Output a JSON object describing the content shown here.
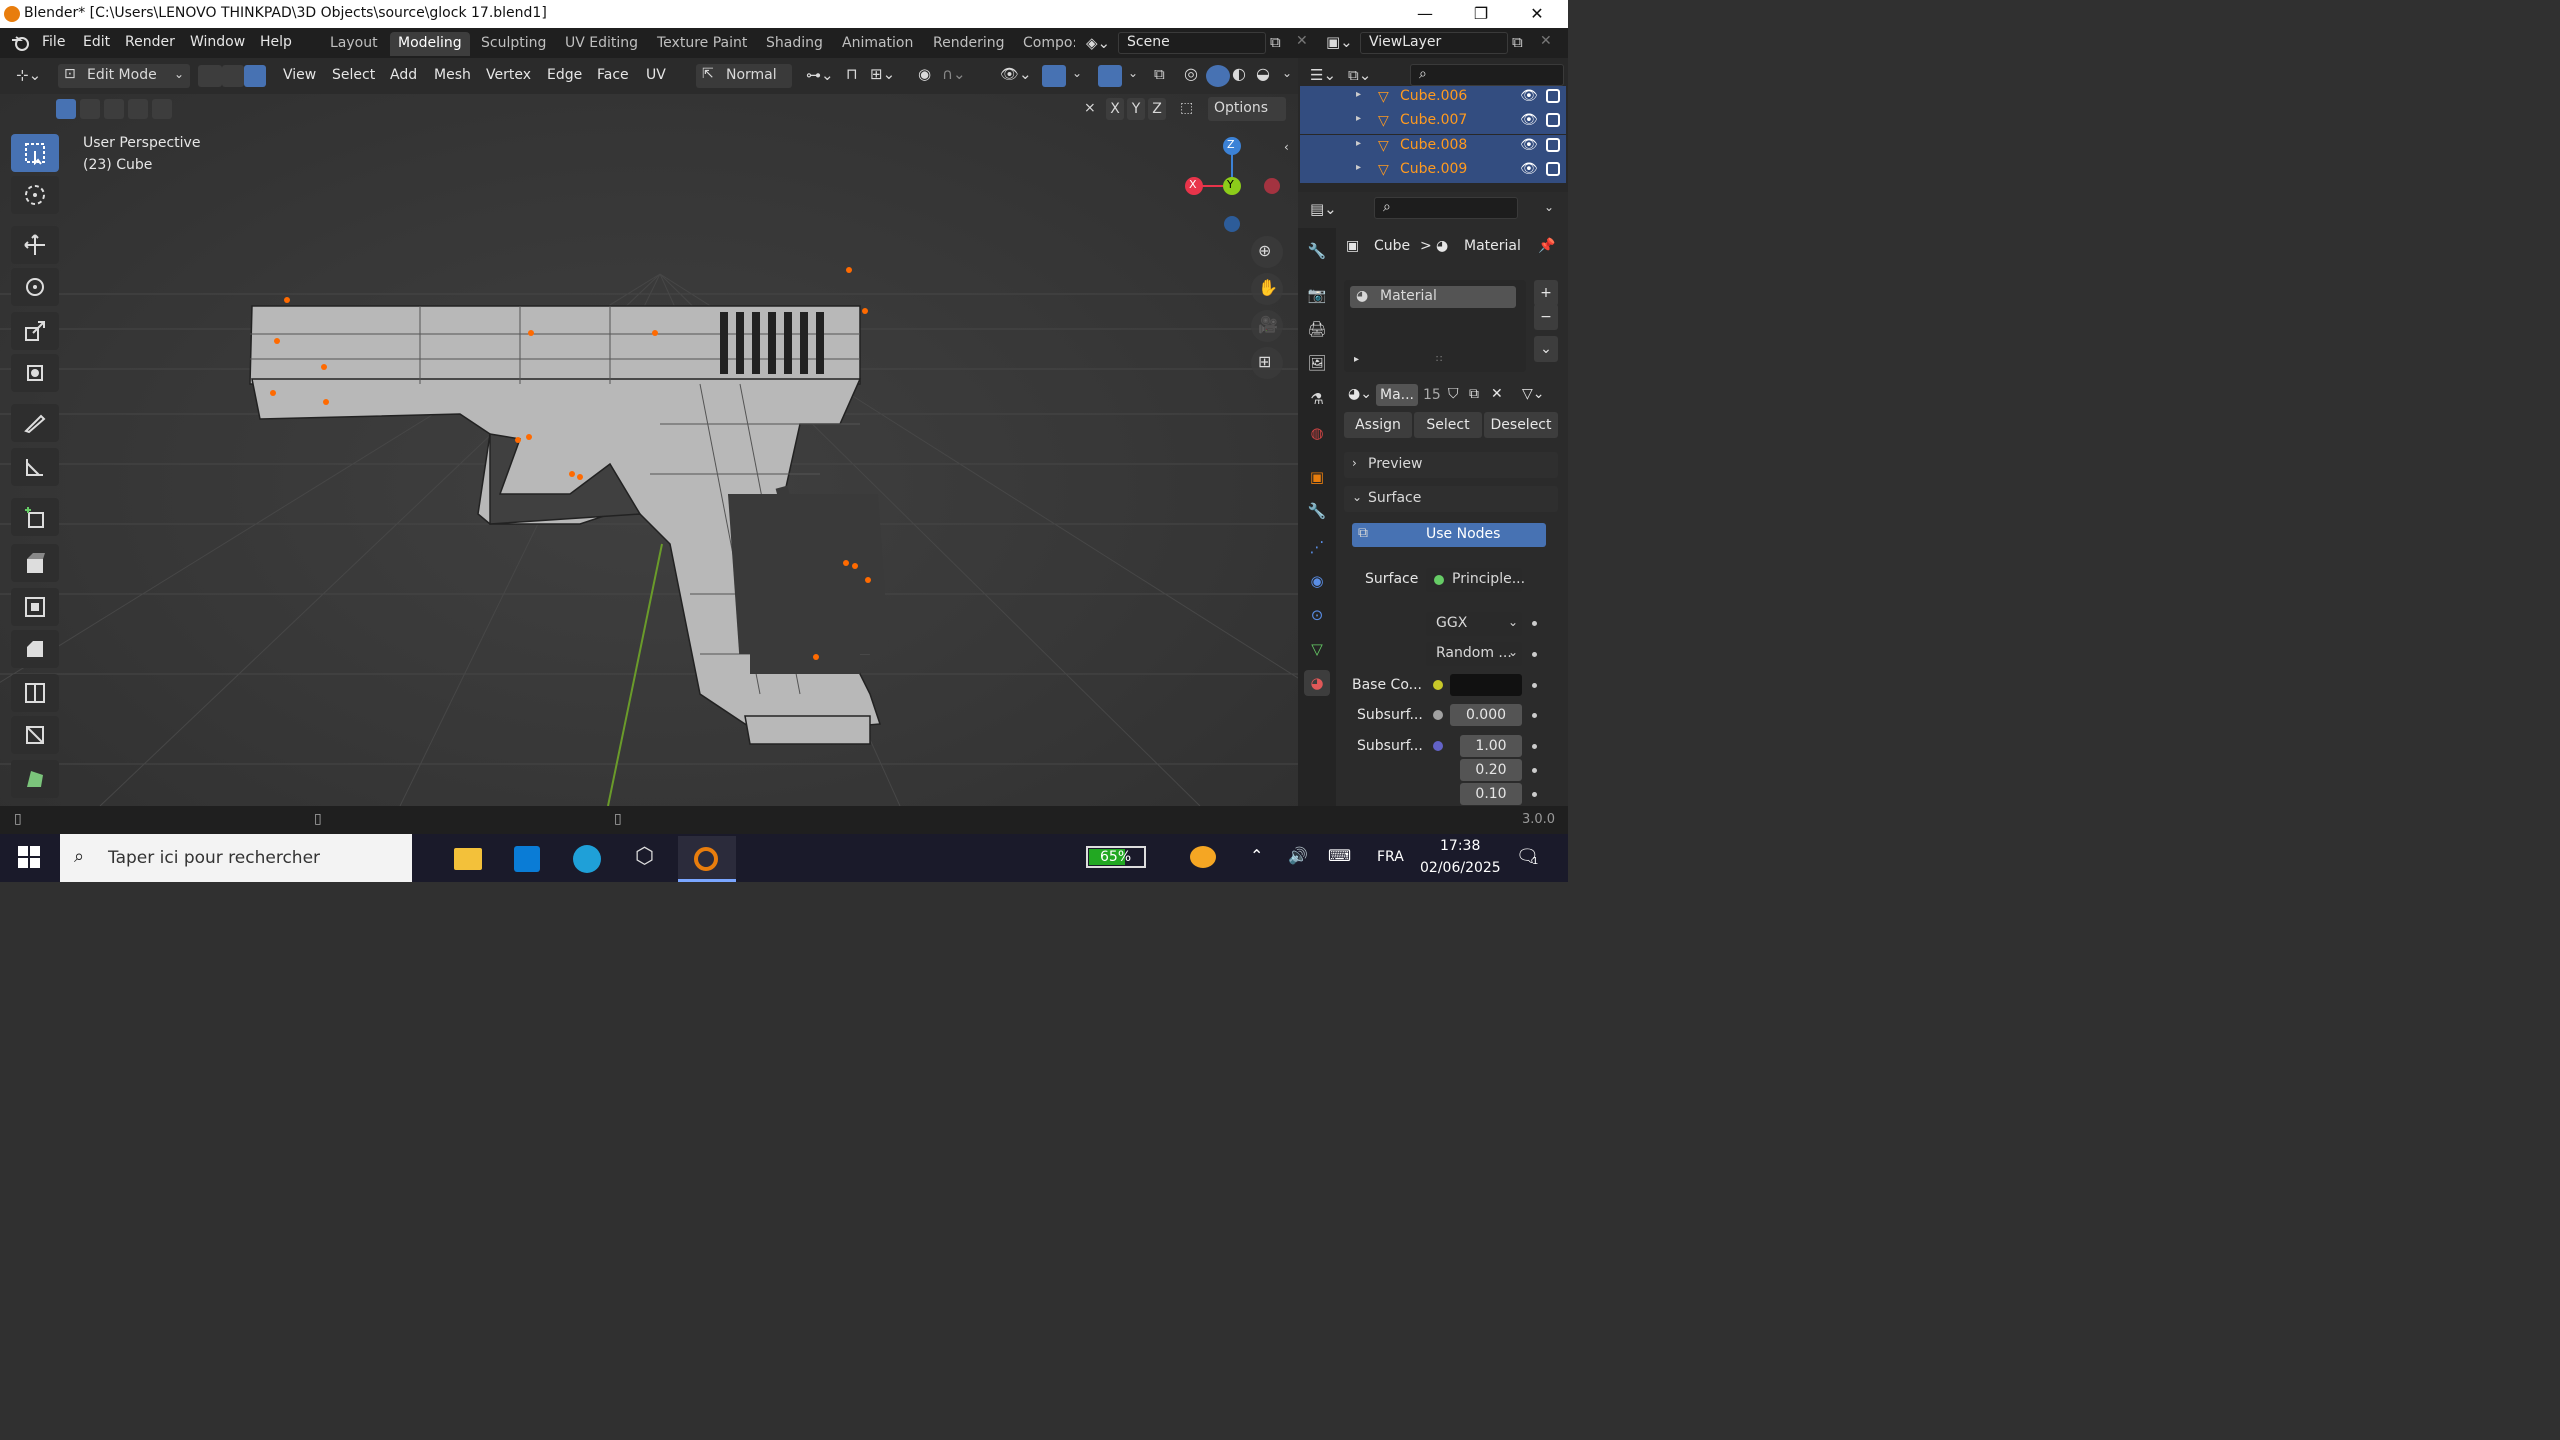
{
  "window": {
    "title": "Blender* [C:\\Users\\LENOVO THINKPAD\\3D Objects\\source\\glock 17.blend1]",
    "controls": [
      "—",
      "❐",
      "✕"
    ]
  },
  "menubar": {
    "items": [
      "File",
      "Edit",
      "Render",
      "Window",
      "Help"
    ],
    "workspaces": [
      "Layout",
      "Modeling",
      "Sculpting",
      "UV Editing",
      "Texture Paint",
      "Shading",
      "Animation",
      "Rendering",
      "Compo:"
    ],
    "active_workspace": "Modeling",
    "scene": "Scene",
    "view_layer": "ViewLayer"
  },
  "viewport_header": {
    "mode": "Edit Mode",
    "menus": [
      "View",
      "Select",
      "Add",
      "Mesh",
      "Vertex",
      "Edge",
      "Face",
      "UV"
    ],
    "orientation": "Normal",
    "axes": [
      "X",
      "Y",
      "Z"
    ],
    "options": "Options"
  },
  "viewport": {
    "view_name": "User Perspective",
    "object_info": "(23) Cube",
    "gizmo": {
      "z": "Z",
      "y": "Y",
      "x": "X"
    }
  },
  "outliner": {
    "rows": [
      {
        "label": "Cube.006"
      },
      {
        "label": "Cube.007"
      },
      {
        "label": "Cube.008"
      },
      {
        "label": "Cube.009"
      }
    ]
  },
  "properties": {
    "breadcrumb_object": "Cube",
    "breadcrumb_sep": ">",
    "breadcrumb_material": "Material",
    "material_slot": "Material",
    "material_name": "Ma...",
    "users": "15",
    "assign": "Assign",
    "select": "Select",
    "deselect": "Deselect",
    "preview_panel": "Preview",
    "surface_panel": "Surface",
    "use_nodes": "Use Nodes",
    "surface_label": "Surface",
    "surface_value": "Principle...",
    "distribution": "GGX",
    "subsurface_method": "Random ...",
    "base_color_label": "Base Co...",
    "subsurface_label": "Subsurf...",
    "subsurface_value": "0.000",
    "subsurface_radius_label": "Subsurf...",
    "radius": [
      "1.00",
      "0.20",
      "0.10"
    ]
  },
  "statusbar": {
    "version": "3.0.0"
  },
  "taskbar": {
    "search_placeholder": "Taper ici pour rechercher",
    "battery": "65%",
    "lang": "FRA",
    "time": "17:38",
    "date": "02/06/2025",
    "notif_count": "1"
  },
  "colors": {
    "accent": "#4772b3",
    "orange": "#ff9a1f",
    "gizmo_x": "#e8344a",
    "gizmo_y": "#8ccc1a",
    "gizmo_z": "#3c82d6"
  }
}
